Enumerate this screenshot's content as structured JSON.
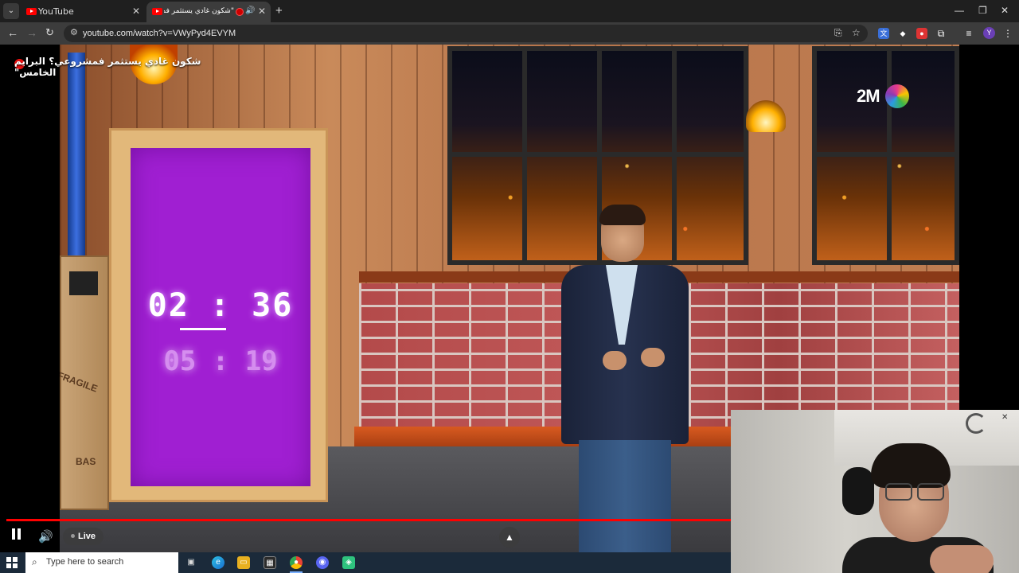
{
  "browser": {
    "tabs": [
      {
        "title": "YouTube",
        "active": false
      },
      {
        "title": "\"شكون غادي يستثمر فمشروعي؟ البرايم الخامس\"",
        "active": true
      }
    ],
    "url": "youtube.com/watch?v=VWyPyd4EVYM",
    "profile_initial": "Y"
  },
  "video": {
    "title": "شكون غادي يستثمر فمشروعي؟ البرايم الخامس\"",
    "channel_logo_text": "2M",
    "timer_main": "02 : 36",
    "timer_secondary": "05 : 19",
    "crate_label_1": "FRAGILE",
    "crate_label_2": "BAS"
  },
  "player": {
    "live_label": "Live",
    "progress": 1.0
  },
  "taskbar": {
    "search_placeholder": "Type here to search"
  },
  "colors": {
    "accent_red": "#ff0000",
    "timer_screen": "#a01fd2",
    "tab_bar": "#1f1f1f",
    "toolbar": "#3c3c3c"
  }
}
